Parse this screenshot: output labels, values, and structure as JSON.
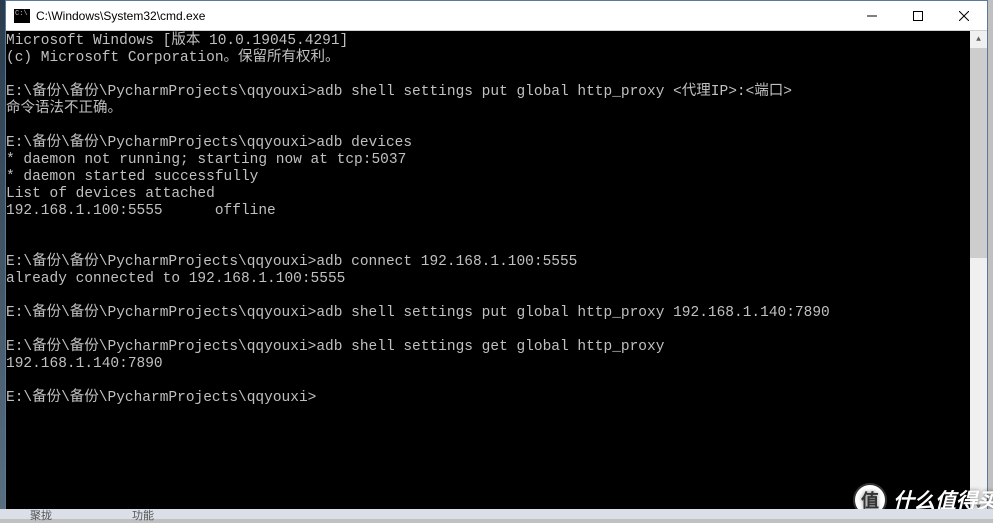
{
  "window": {
    "title": "C:\\Windows\\System32\\cmd.exe"
  },
  "terminal": {
    "lines": [
      "Microsoft Windows [版本 10.0.19045.4291]",
      "(c) Microsoft Corporation。保留所有权利。",
      "",
      "E:\\备份\\备份\\PycharmProjects\\qqyouxi>adb shell settings put global http_proxy <代理IP>:<端口>",
      "命令语法不正确。",
      "",
      "E:\\备份\\备份\\PycharmProjects\\qqyouxi>adb devices",
      "* daemon not running; starting now at tcp:5037",
      "* daemon started successfully",
      "List of devices attached",
      "192.168.1.100:5555      offline",
      "",
      "",
      "E:\\备份\\备份\\PycharmProjects\\qqyouxi>adb connect 192.168.1.100:5555",
      "already connected to 192.168.1.100:5555",
      "",
      "E:\\备份\\备份\\PycharmProjects\\qqyouxi>adb shell settings put global http_proxy 192.168.1.140:7890",
      "",
      "E:\\备份\\备份\\PycharmProjects\\qqyouxi>adb shell settings get global http_proxy",
      "192.168.1.140:7890",
      "",
      "E:\\备份\\备份\\PycharmProjects\\qqyouxi>"
    ]
  },
  "watermark": {
    "icon": "值",
    "text": "什么值得买"
  },
  "taskbar": {
    "hint1": "聚拢",
    "hint2": "功能"
  }
}
